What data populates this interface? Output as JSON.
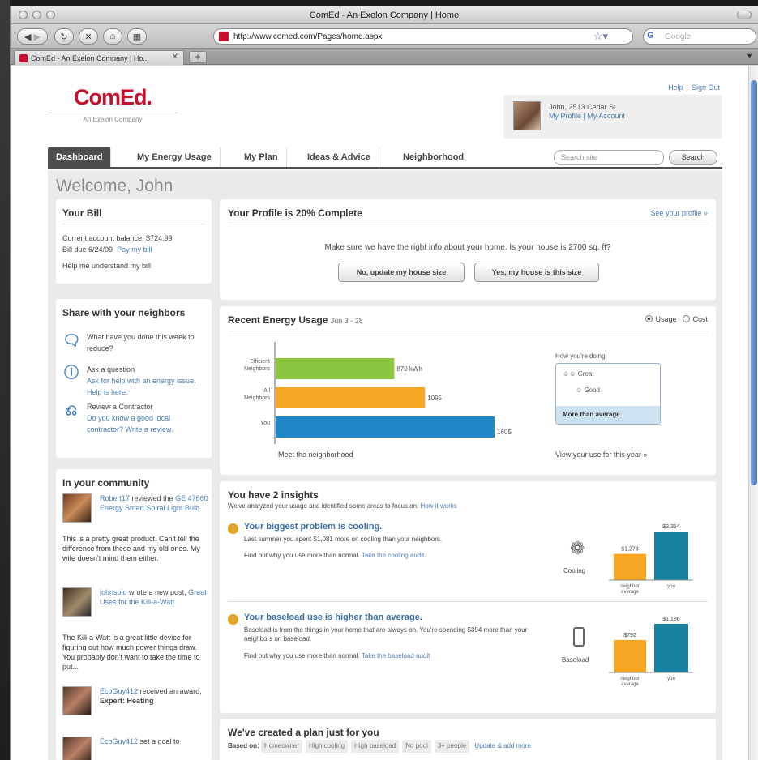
{
  "browser": {
    "window_title": "ComEd - An Exelon Company | Home",
    "url": "http://www.comed.com/Pages/home.aspx",
    "search_placeholder": "Google",
    "tab_title": "ComEd - An Exelon Company | Ho...",
    "new_tab_label": "+"
  },
  "site": {
    "logo": "ComEd.",
    "logo_sub": "An Exelon Company",
    "help": "Help",
    "sign_out": "Sign Out",
    "user_line": "John, 2513 Cedar St",
    "my_profile": "My Profile",
    "my_account": "My Account",
    "search_placeholder": "Search site",
    "search_button": "Search"
  },
  "nav": {
    "tabs": [
      {
        "label": "Dashboard"
      },
      {
        "label": "My Energy Usage"
      },
      {
        "label": "My Plan"
      },
      {
        "label": "Ideas & Advice"
      },
      {
        "label": "Neighborhood"
      }
    ]
  },
  "welcome": "Welcome, John",
  "bill": {
    "title": "Your Bill",
    "balance": "Current account balance: $724.99",
    "due": "Bill due 6/24/09",
    "pay": "Pay my bill",
    "help": "Help me understand my bill"
  },
  "share": {
    "title": "Share with your neighbors",
    "items": [
      {
        "icon": "speech-bubble-icon",
        "title": "",
        "text": "What have you done this week to reduce?"
      },
      {
        "icon": "question-icon",
        "title": "Ask a question",
        "text": "Ask for help with an energy issue. Help is here."
      },
      {
        "icon": "paint-roller-icon",
        "title": "Review a Contractor",
        "text": "Do you know a good local contractor? Write a review."
      }
    ]
  },
  "community": {
    "title": "In your community",
    "entries": [
      {
        "user": "Robert17",
        "action": " reviewed the ",
        "link": "GE 47660 Energy Smart Spiral Light Bulb",
        "body": "This is a pretty great product. Can't tell the difference from these and my old ones. My wife doesn't mind them either."
      },
      {
        "user": "johnsolo",
        "action": " wrote a new post, ",
        "link": "Great Uses for the Kill-a-Watt",
        "body": "The Kill-a-Watt is a great little device for figuring out how much power things draw. You probably don't want to take the time to put..."
      },
      {
        "user": "EcoGuy412",
        "action": " received an award, ",
        "link": "Expert: Heating",
        "body": ""
      },
      {
        "user": "EcoGuy412",
        "action": " set a goal to",
        "link": "",
        "body": ""
      }
    ]
  },
  "profile_card": {
    "title": "Your Profile is 20% Complete",
    "see_link": "See your profile »",
    "question": "Make sure we have the right info about your home. Is your house is 2700 sq. ft?",
    "btn_no": "No, update my house size",
    "btn_yes": "Yes, my house is this size"
  },
  "energy": {
    "title": "Recent Energy Usage",
    "date_range": "Jun 3 - 28",
    "radio_usage": "Usage",
    "radio_cost": "Cost",
    "meet_link": "Meet the neighborhood",
    "view_link": "View your use for this year »",
    "how_title": "How you're doing",
    "how_great": "Great",
    "how_good": "Good",
    "how_status": "More than average"
  },
  "chart_data": {
    "type": "bar",
    "orientation": "horizontal",
    "categories": [
      "Efficient Neighbors",
      "All Neighbors",
      "You"
    ],
    "values": [
      870,
      1095,
      1605
    ],
    "value_labels": [
      "870 kWh",
      "1095",
      "1605"
    ],
    "colors": [
      "#8cc63f",
      "#f5a623",
      "#1f86c8"
    ]
  },
  "insights": {
    "title": "You have 2 insights",
    "subtitle": "We've analyzed your usage and identified some areas to focus on.",
    "how_link": "How it works",
    "items": [
      {
        "title": "Your biggest problem is cooling.",
        "text": "Last summer you spent $1,081 more on cooling than your neighbors.",
        "cta": "Find out why you use more than normal.",
        "link": "Take the cooling audit.",
        "icon_label": "Cooling",
        "neighbor_value": "$1,273",
        "you_value": "$2,354",
        "neighbor_amount": 1273,
        "you_amount": 2354,
        "neighbor_label": "neighbor average",
        "you_label": "you"
      },
      {
        "title": "Your baseload use is higher than average.",
        "text": "Baseload is from the things in your home that are always on. You're spending $394 more than your neighbors on baseload.",
        "cta": "Find out why you use more than normal.",
        "link": "Take the baseload audit",
        "icon_label": "Baseload",
        "neighbor_value": "$792",
        "you_value": "$1,186",
        "neighbor_amount": 792,
        "you_amount": 1186,
        "neighbor_label": "neighbor average",
        "you_label": "you"
      }
    ]
  },
  "plan": {
    "title": "We've created a plan just for you",
    "based_on": "Based on:",
    "chips": [
      "Homeowner",
      "High cooling",
      "High baseload",
      "No pool",
      "3+ people"
    ],
    "update_link": "Update & add more"
  },
  "colors": {
    "brand": "#c8102e",
    "link": "#4a7db5",
    "bar_orange": "#f5a623",
    "bar_teal": "#17809e"
  }
}
